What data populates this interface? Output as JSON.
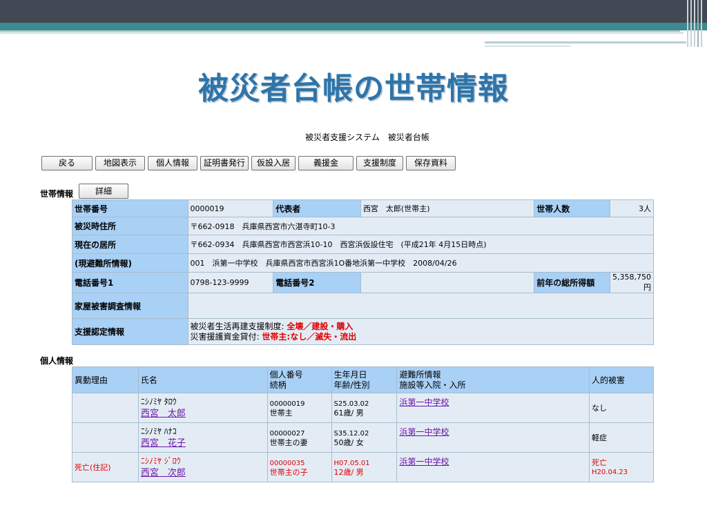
{
  "slide": {
    "title": "被災者台帳の世帯情報"
  },
  "system_title": "被災者支援システム　被災者台帳",
  "nav_buttons": [
    "戻る",
    "地図表示",
    "個人情報",
    "証明書発行",
    "仮設入居",
    "義援金",
    "支援制度",
    "保存資料"
  ],
  "household": {
    "section_label": "世帯情報",
    "detail_button": "詳細",
    "rows": {
      "no_label": "世帯番号",
      "no_value": "0000019",
      "rep_label": "代表者",
      "rep_value": "西宮　太郎(世帯主)",
      "members_label": "世帯人数",
      "members_value": "3人",
      "addr_label": "被災時住所",
      "addr_value": "〒662-0918　兵庫県西宮市六湛寺町10-3",
      "current_label": "現在の居所",
      "current_value": "〒662-0934　兵庫県西宮市西宮浜10-10　西宮浜仮設住宅　(平成21年 4月15日時点)",
      "shelter_label": "(現避難所情報)",
      "shelter_value": "001　浜第一中学校　兵庫県西宮市西宮浜1O番地浜第一中学校　2008/04/26",
      "tel1_label": "電話番号1",
      "tel1_value": "0798-123-9999",
      "tel2_label": "電話番号2",
      "tel2_value": "",
      "income_label": "前年の総所得額",
      "income_value": "5,358,750円",
      "damage_label": "家屋被害調査情報",
      "damage_value": "",
      "support_label": "支援認定情報",
      "support_line1_prefix": "被災者生活再建支援制度:",
      "support_line1_value": "全壊／建設・購入",
      "support_line2_prefix": "災害援護資金貸付:",
      "support_line2_value": "世帯主:なし／滅失・流出"
    }
  },
  "persons": {
    "section_label": "個人情報",
    "headers": {
      "reason": "異動理由",
      "name": "氏名",
      "id_line1": "個人番号",
      "id_line2": "続柄",
      "dob_line1": "生年月日",
      "dob_line2": "年齢/性別",
      "shelter_line1": "避難所情報",
      "shelter_line2": "施設等入院・入所",
      "damage": "人的被害"
    },
    "rows": [
      {
        "reason": "",
        "kana": "ﾆｼﾉﾐﾔ ﾀﾛｳ",
        "name": "西宮　太郎",
        "id": "00000019",
        "rel": "世帯主",
        "dob": "S25.03.02",
        "age": "61歳/ 男",
        "shelter": "浜第一中学校",
        "damage": "なし",
        "damage_date": ""
      },
      {
        "reason": "",
        "kana": "ﾆｼﾉﾐﾔ ﾊﾅｺ",
        "name": "西宮　花子",
        "id": "00000027",
        "rel": "世帯主の妻",
        "dob": "S35.12.02",
        "age": "50歳/ 女",
        "shelter": "浜第一中学校",
        "damage": "軽症",
        "damage_date": ""
      },
      {
        "reason": "死亡(住記)",
        "kana": "ﾆｼﾉﾐﾔ ｼﾞﾛｳ",
        "name": "西宮　次郎",
        "id": "00000035",
        "rel": "世帯主の子",
        "dob": "H07.05.01",
        "age": "12歳/ 男",
        "shelter": "浜第一中学校",
        "damage": "死亡",
        "damage_date": "H20.04.23"
      }
    ]
  },
  "colors": {
    "header_bg": "#a9d0f5",
    "value_bg": "#e3ecf5",
    "title": "#2f74a8",
    "alert": "#e00000",
    "link": "#6b14a8"
  }
}
